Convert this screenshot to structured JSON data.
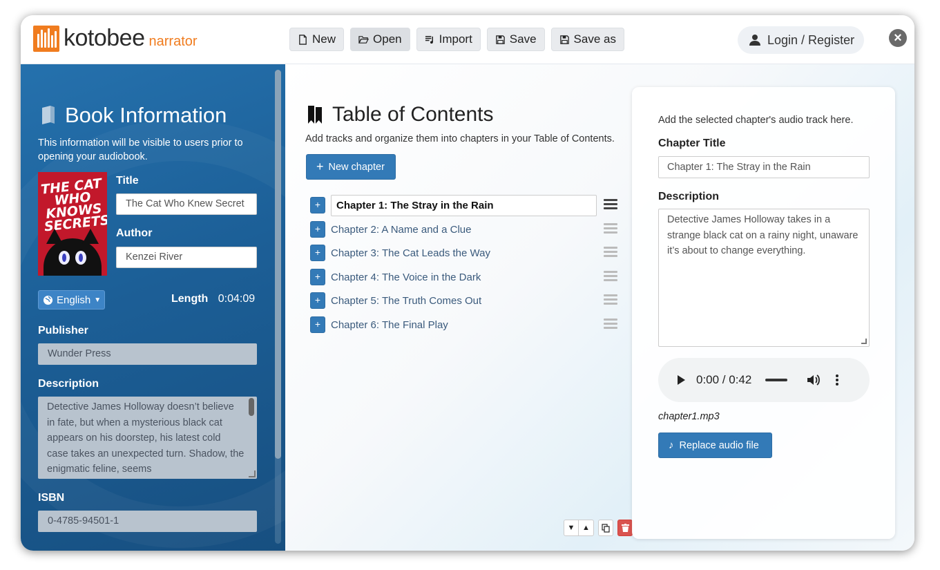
{
  "brand": {
    "name": "kotobee",
    "product": "narrator",
    "accent": "#f07c1f"
  },
  "toolbar": {
    "new_label": "New",
    "open_label": "Open",
    "import_label": "Import",
    "save_label": "Save",
    "save_as_label": "Save as"
  },
  "account": {
    "login_label": "Login / Register"
  },
  "book_info": {
    "heading": "Book Information",
    "note": "This information will be visible to users prior to opening your audiobook.",
    "cover_text": "THE CAT WHO KNOWS SECRETS",
    "title_label": "Title",
    "title_value": "The Cat Who Knew Secret",
    "author_label": "Author",
    "author_value": "Kenzei River",
    "language": "English",
    "length_label": "Length",
    "length_value": "0:04:09",
    "publisher_label": "Publisher",
    "publisher_value": "Wunder Press",
    "description_label": "Description",
    "description_value": "Detective James Holloway doesn’t believe in fate, but when a mysterious black cat appears on his doorstep, his latest cold case takes an unexpected turn. Shadow, the enigmatic feline, seems",
    "isbn_label": "ISBN",
    "isbn_value": "0-4785-94501-1"
  },
  "toc": {
    "heading": "Table of Contents",
    "note": "Add tracks and organize them into chapters in your Table of Contents.",
    "new_chapter_label": "New chapter",
    "chapters": [
      {
        "title": "Chapter 1: The Stray in the Rain",
        "selected": true
      },
      {
        "title": "Chapter 2: A Name and a Clue"
      },
      {
        "title": "Chapter 3: The Cat Leads the Way"
      },
      {
        "title": "Chapter 4: The Voice in the Dark"
      },
      {
        "title": "Chapter 5: The Truth Comes Out"
      },
      {
        "title": "Chapter 6: The Final Play"
      }
    ]
  },
  "chapter_panel": {
    "note": "Add the selected chapter's audio track here.",
    "title_label": "Chapter Title",
    "title_value": "Chapter 1: The Stray in the Rain",
    "description_label": "Description",
    "description_value": "Detective James Holloway takes in a strange black cat on a rainy night, unaware it’s about to change everything.",
    "audio_time": "0:00 / 0:42",
    "file_name": "chapter1.mp3",
    "replace_label": "Replace audio file"
  },
  "icons": {
    "new": "file-icon",
    "open": "folder-open-icon",
    "import": "playlist-icon",
    "save": "floppy-icon",
    "user": "user-icon",
    "close": "close-icon",
    "book": "book-icon",
    "bookmark": "bookmark-icon",
    "globe": "globe-icon",
    "music": "music-note-icon",
    "trash": "trash-icon",
    "copy": "copy-icon"
  }
}
